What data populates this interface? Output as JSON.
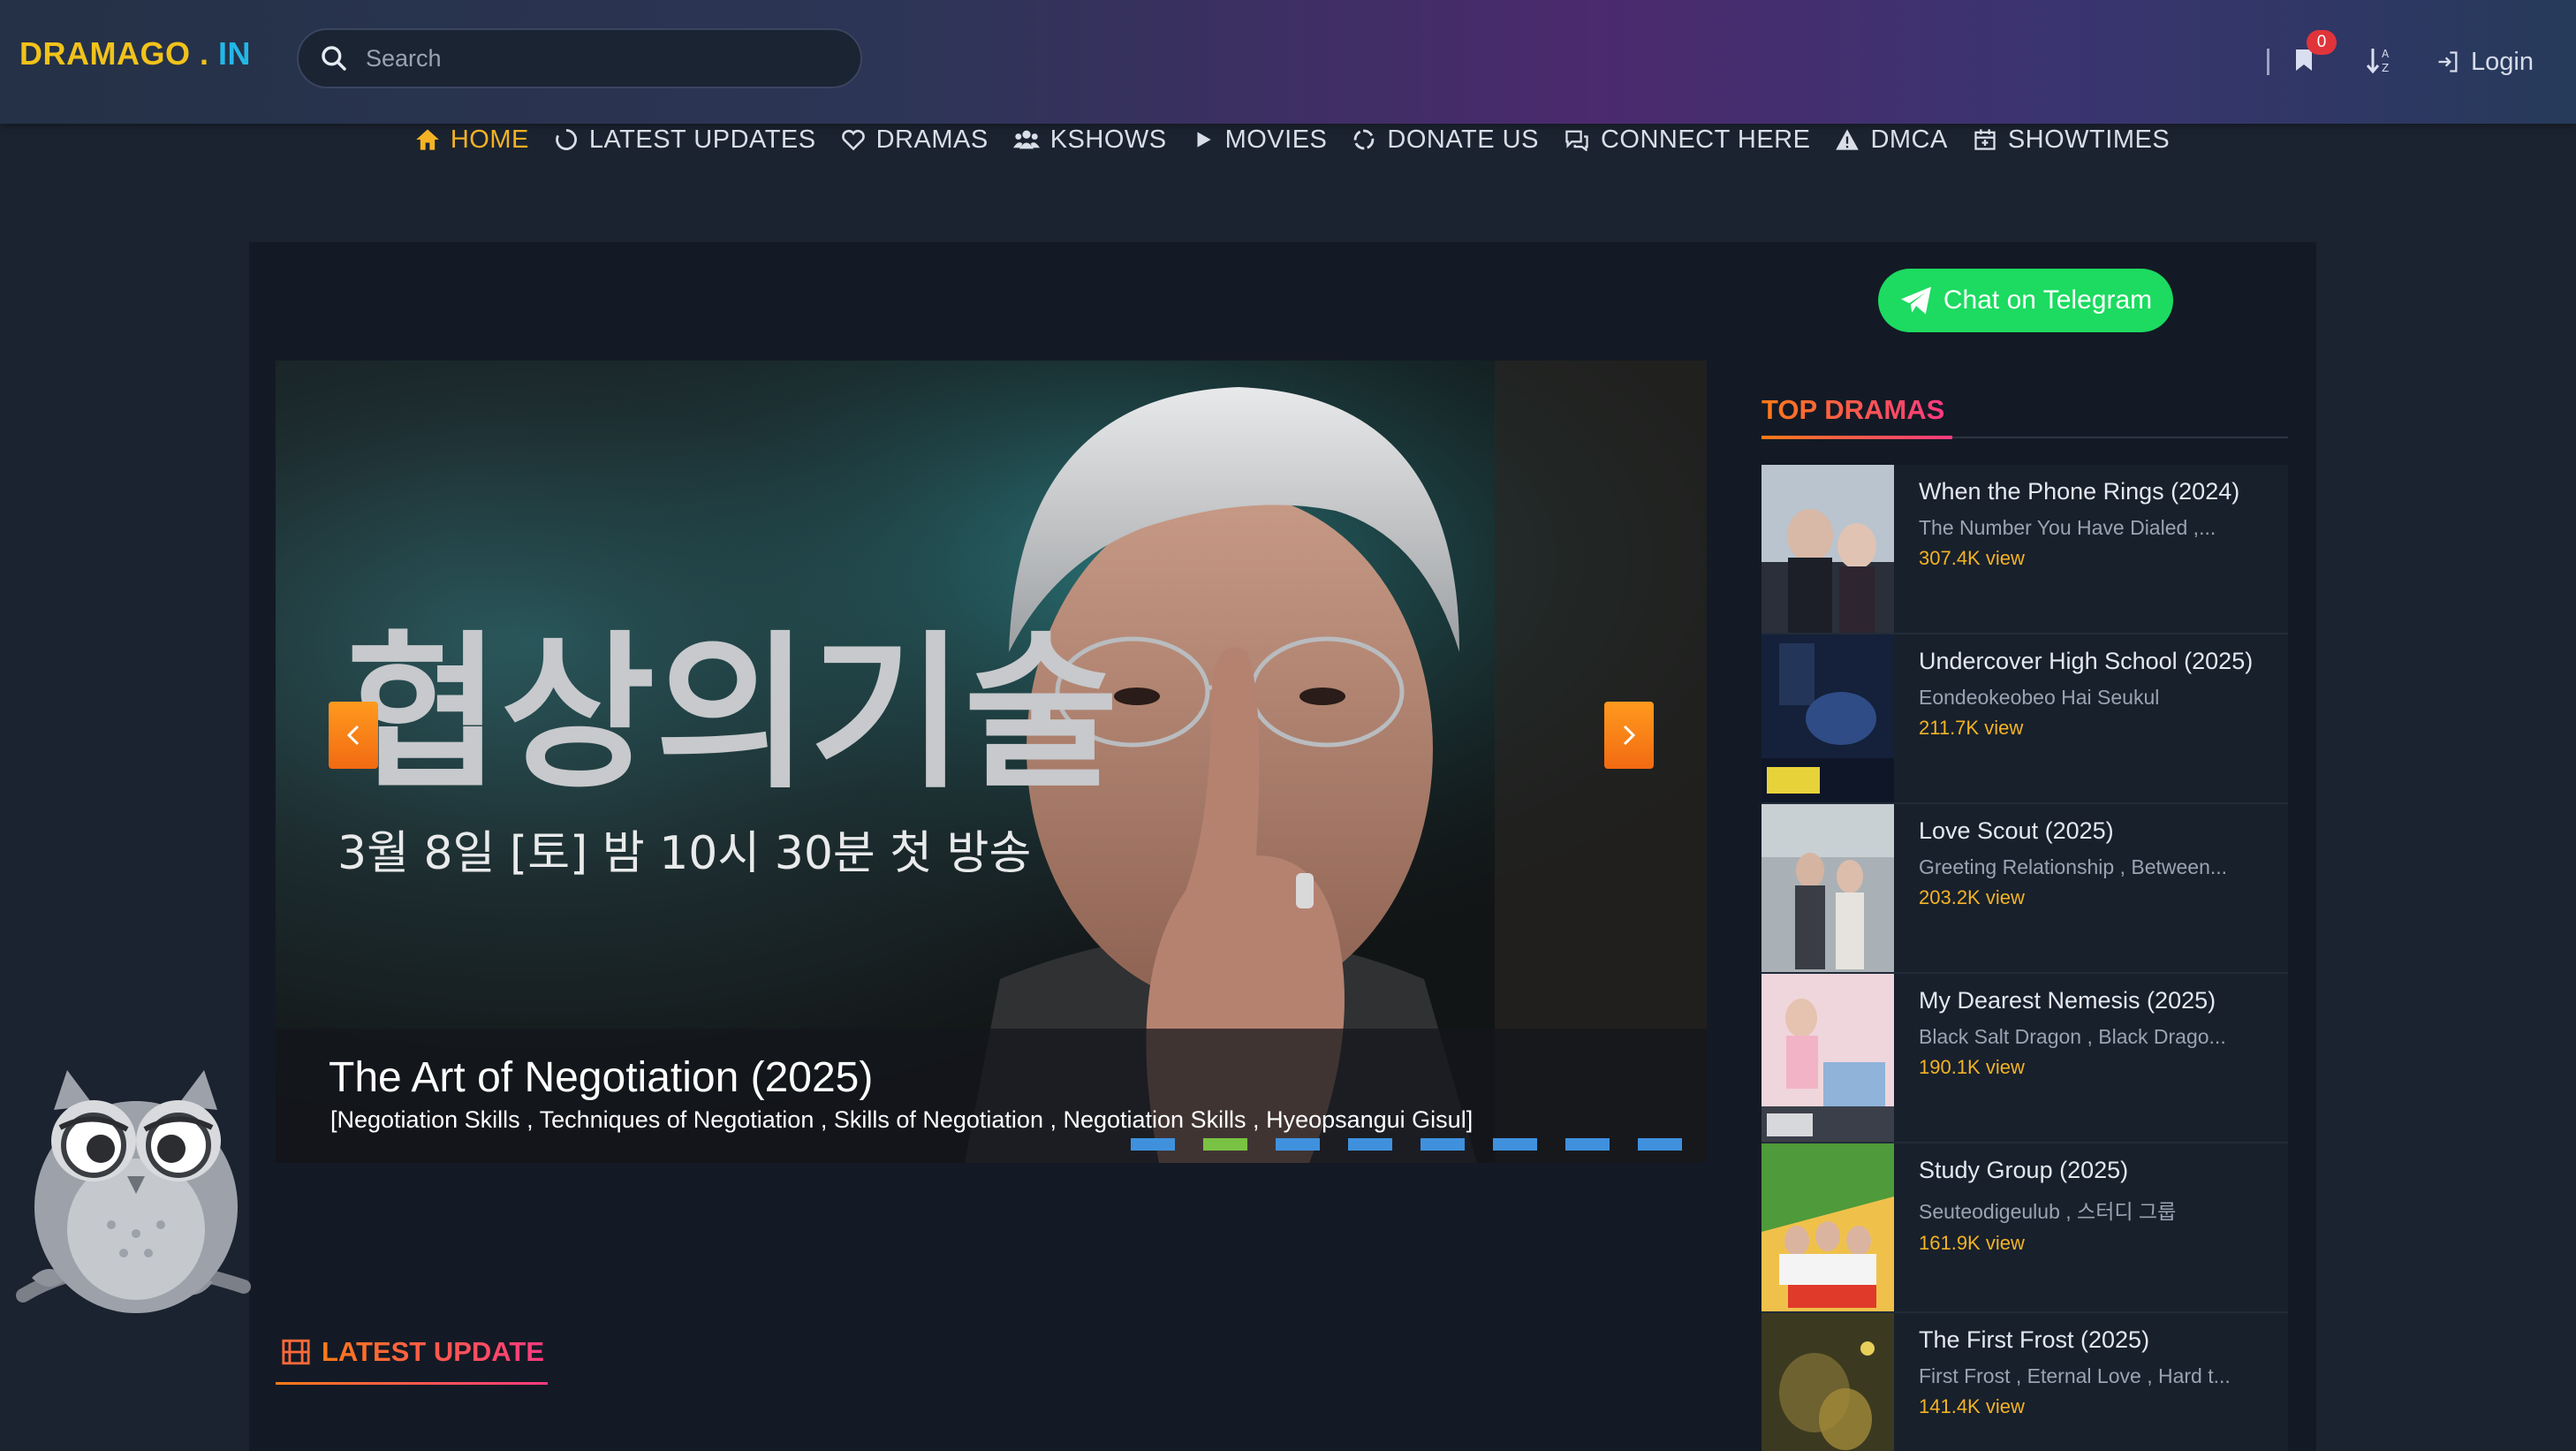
{
  "header": {
    "logo": {
      "part1": "DRAMAGO",
      "part2": " . ",
      "part3": "IN"
    },
    "search_placeholder": "Search",
    "bookmark_count": "0",
    "login_label": "Login"
  },
  "nav": {
    "items": [
      {
        "label": "HOME",
        "icon": "home-icon",
        "active": true
      },
      {
        "label": "LATEST UPDATES",
        "icon": "spinner-icon"
      },
      {
        "label": "DRAMAS",
        "icon": "heart-icon"
      },
      {
        "label": "KSHOWS",
        "icon": "users-icon"
      },
      {
        "label": "MOVIES",
        "icon": "play-icon"
      },
      {
        "label": "DONATE US",
        "icon": "refresh-icon"
      },
      {
        "label": "CONNECT HERE",
        "icon": "comments-icon"
      },
      {
        "label": "DMCA",
        "icon": "warning-icon"
      },
      {
        "label": "SHOWTIMES",
        "icon": "calendar-icon"
      }
    ]
  },
  "telegram_label": "Chat on Telegram",
  "slider": {
    "poster_title_ko": "협상의기술",
    "poster_airdate_ko": "3월 8일 [토] 밤 10시 30분 첫 방송",
    "title": "The Art of Negotiation (2025)",
    "subtitle": "[Negotiation Skills , Techniques of Negotiation , Skills of Negotiation , Negotiation Skills , Hyeopsangui Gisul]",
    "dot_count": 8,
    "active_dot": 1
  },
  "latest_update_heading": "LATEST UPDATE",
  "top_dramas": {
    "heading": "TOP DRAMAS",
    "items": [
      {
        "title": "When the Phone Rings (2024)",
        "alt": "The Number You Have Dialed ,...",
        "views": "307.4K view"
      },
      {
        "title": "Undercover High School (2025)",
        "alt": "Eondeokeobeo Hai Seukul",
        "views": "211.7K view"
      },
      {
        "title": "Love Scout (2025)",
        "alt": "Greeting Relationship , Between...",
        "views": "203.2K view"
      },
      {
        "title": "My Dearest Nemesis (2025)",
        "alt": "Black Salt Dragon , Black Drago...",
        "views": "190.1K view"
      },
      {
        "title": "Study Group (2025)",
        "alt": "Seuteodigeulub , 스터디 그룹",
        "views": "161.9K view"
      },
      {
        "title": "The First Frost (2025)",
        "alt": "First Frost , Eternal Love , Hard t...",
        "views": "141.4K view"
      }
    ]
  },
  "colors": {
    "accent": "#f3b324",
    "telegram": "#1cdb60",
    "dot": "#3f91de",
    "dot_active": "#7ac243"
  }
}
